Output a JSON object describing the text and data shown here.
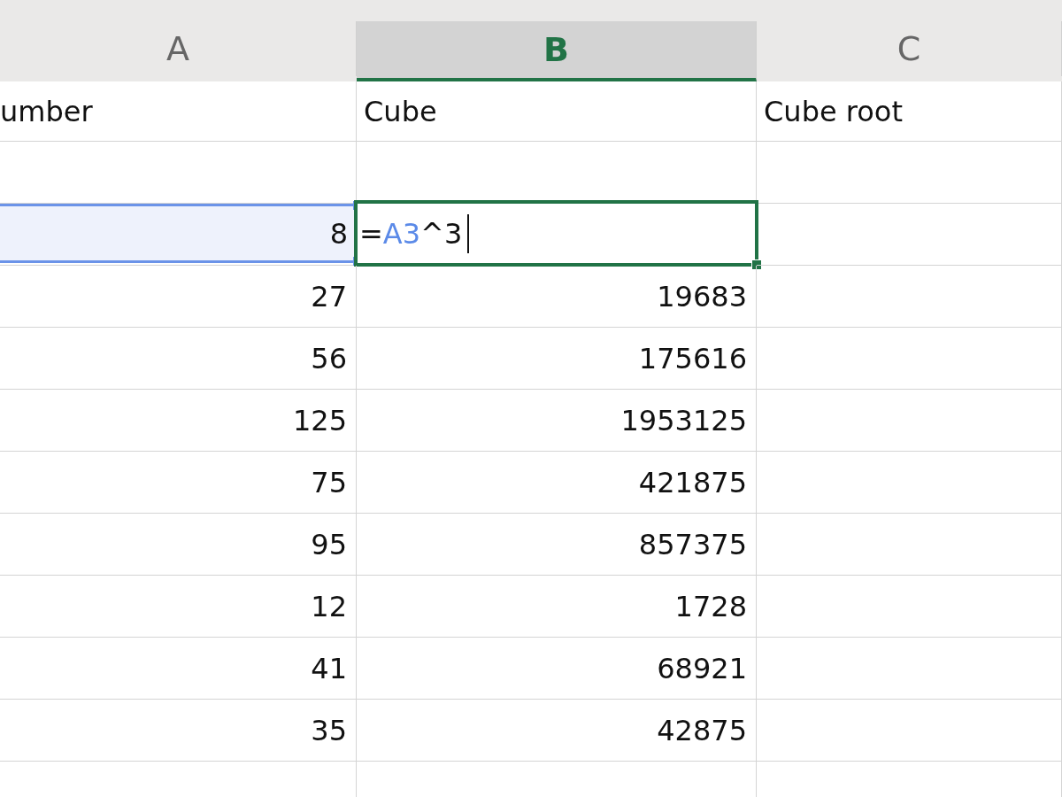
{
  "columns": [
    {
      "label": "A",
      "selected": false
    },
    {
      "label": "B",
      "selected": true
    },
    {
      "label": "C",
      "selected": false
    }
  ],
  "rows": [
    {
      "kind": "text",
      "a": "umber",
      "b": "Cube",
      "c": "Cube root"
    },
    {
      "kind": "blank"
    },
    {
      "kind": "number",
      "a": "8",
      "referenced": true,
      "editing": true,
      "b_formula": [
        {
          "kind": "plain",
          "text": "="
        },
        {
          "kind": "ref",
          "text": "A3"
        },
        {
          "kind": "plain",
          "text": "^3"
        }
      ]
    },
    {
      "kind": "number",
      "a": "27",
      "b": "19683",
      "referenced": false,
      "editing": false
    },
    {
      "kind": "number",
      "a": "56",
      "b": "175616",
      "referenced": false,
      "editing": false
    },
    {
      "kind": "number",
      "a": "125",
      "b": "1953125",
      "referenced": false,
      "editing": false
    },
    {
      "kind": "number",
      "a": "75",
      "b": "421875",
      "referenced": false,
      "editing": false
    },
    {
      "kind": "number",
      "a": "95",
      "b": "857375",
      "referenced": false,
      "editing": false
    },
    {
      "kind": "number",
      "a": "12",
      "b": "1728",
      "referenced": false,
      "editing": false
    },
    {
      "kind": "number",
      "a": "41",
      "b": "68921",
      "referenced": false,
      "editing": false
    },
    {
      "kind": "number",
      "a": "35",
      "b": "42875",
      "referenced": false,
      "editing": false
    },
    {
      "kind": "blank"
    }
  ]
}
